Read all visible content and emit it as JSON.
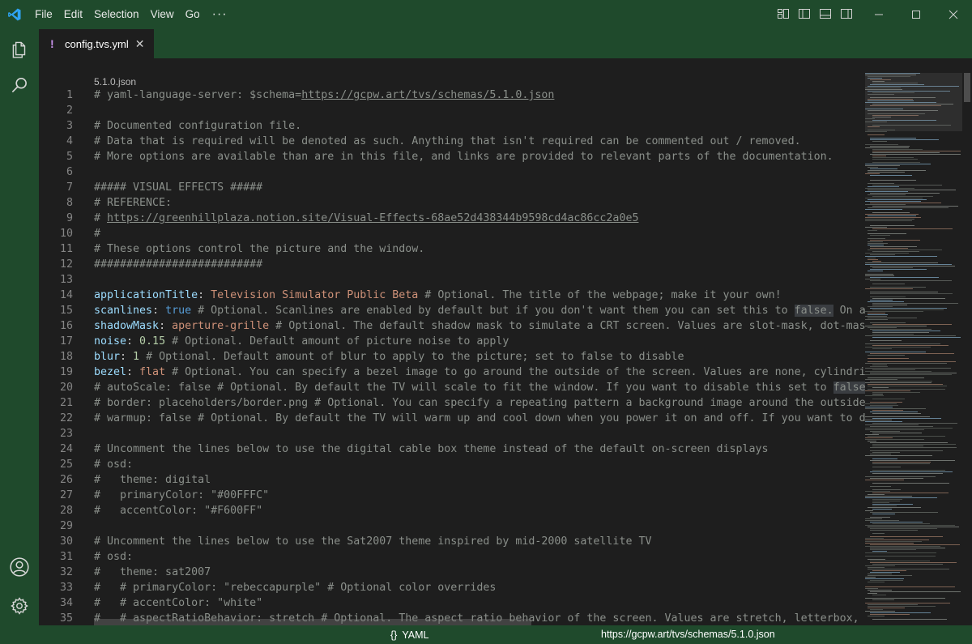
{
  "window": {
    "menu": [
      "File",
      "Edit",
      "Selection",
      "View",
      "Go"
    ],
    "more_label": "···"
  },
  "tab": {
    "icon": "!",
    "label": "config.tvs.yml",
    "close": "✕"
  },
  "editor": {
    "breadcrumb": "5.1.0.json",
    "lines": [
      {
        "n": "1",
        "seg": [
          {
            "t": "# yaml-language-server: $schema=",
            "c": "t-c"
          },
          {
            "t": "https://gcpw.art/tvs/schemas/5.1.0.json",
            "c": "t-u"
          }
        ]
      },
      {
        "n": "2",
        "seg": []
      },
      {
        "n": "3",
        "seg": [
          {
            "t": "# Documented configuration file.",
            "c": "t-c"
          }
        ]
      },
      {
        "n": "4",
        "seg": [
          {
            "t": "# Data that is required will be denoted as such. Anything that isn't required can be commented out / removed.",
            "c": "t-c"
          }
        ]
      },
      {
        "n": "5",
        "seg": [
          {
            "t": "# More options are available than are in this file, and links are provided to relevant parts of the documentation.",
            "c": "t-c"
          }
        ]
      },
      {
        "n": "6",
        "seg": []
      },
      {
        "n": "7",
        "seg": [
          {
            "t": "##### VISUAL EFFECTS #####",
            "c": "t-c"
          }
        ]
      },
      {
        "n": "8",
        "seg": [
          {
            "t": "# REFERENCE:",
            "c": "t-c"
          }
        ]
      },
      {
        "n": "9",
        "seg": [
          {
            "t": "# ",
            "c": "t-c"
          },
          {
            "t": "https://greenhillplaza.notion.site/Visual-Effects-68ae52d438344b9598cd4ac86cc2a0e5",
            "c": "t-u"
          }
        ]
      },
      {
        "n": "10",
        "seg": [
          {
            "t": "#",
            "c": "t-c"
          }
        ]
      },
      {
        "n": "11",
        "seg": [
          {
            "t": "# These options control the picture and the window.",
            "c": "t-c"
          }
        ]
      },
      {
        "n": "12",
        "seg": [
          {
            "t": "##########################",
            "c": "t-c"
          }
        ]
      },
      {
        "n": "13",
        "seg": []
      },
      {
        "n": "14",
        "seg": [
          {
            "t": "applicationTitle",
            "c": "t-k"
          },
          {
            "t": ": ",
            "c": ""
          },
          {
            "t": "Television Simulator Public Beta",
            "c": "t-s"
          },
          {
            "t": " # Optional. The title of the webpage; make it your own!",
            "c": "t-c"
          }
        ]
      },
      {
        "n": "15",
        "seg": [
          {
            "t": "scanlines",
            "c": "t-k"
          },
          {
            "t": ": ",
            "c": ""
          },
          {
            "t": "true",
            "c": "t-b"
          },
          {
            "t": " # Optional. Scanlines are enabled by default but if you don't want them you can set this to ",
            "c": "t-c"
          },
          {
            "t": "false.",
            "c": "t-h"
          },
          {
            "t": " On a real",
            "c": "t-c"
          }
        ]
      },
      {
        "n": "16",
        "seg": [
          {
            "t": "shadowMask",
            "c": "t-k"
          },
          {
            "t": ": ",
            "c": ""
          },
          {
            "t": "aperture-grille",
            "c": "t-s"
          },
          {
            "t": " # Optional. The default shadow mask to simulate a CRT screen. Values are slot-mask, dot-mask, or",
            "c": "t-c"
          }
        ]
      },
      {
        "n": "17",
        "seg": [
          {
            "t": "noise",
            "c": "t-k"
          },
          {
            "t": ": ",
            "c": ""
          },
          {
            "t": "0.15",
            "c": "t-n"
          },
          {
            "t": " # Optional. Default amount of picture noise to apply",
            "c": "t-c"
          }
        ]
      },
      {
        "n": "18",
        "seg": [
          {
            "t": "blur",
            "c": "t-k"
          },
          {
            "t": ": ",
            "c": ""
          },
          {
            "t": "1",
            "c": "t-n"
          },
          {
            "t": " # Optional. Default amount of blur to apply to the picture; set to false to disable",
            "c": "t-c"
          }
        ]
      },
      {
        "n": "19",
        "seg": [
          {
            "t": "bezel",
            "c": "t-k"
          },
          {
            "t": ": ",
            "c": ""
          },
          {
            "t": "flat",
            "c": "t-s"
          },
          {
            "t": " # Optional. You can specify a bezel image to go around the outside of the screen. Values are none, cylindrical or",
            "c": "t-c"
          }
        ]
      },
      {
        "n": "20",
        "seg": [
          {
            "t": "# autoScale: false # Optional. By default the TV will scale to fit the window. If you want to disable this set to ",
            "c": "t-c"
          },
          {
            "t": "false.",
            "c": "t-h"
          }
        ]
      },
      {
        "n": "21",
        "seg": [
          {
            "t": "# border: placeholders/border.png # Optional. You can specify a repeating pattern a background image around the outside of t",
            "c": "t-c"
          }
        ]
      },
      {
        "n": "22",
        "seg": [
          {
            "t": "# warmup: false # Optional. By default the TV will warm up and cool down when you power it on and off. If you want to disab",
            "c": "t-c"
          }
        ]
      },
      {
        "n": "23",
        "seg": []
      },
      {
        "n": "24",
        "seg": [
          {
            "t": "# Uncomment the lines below to use the digital cable box theme instead of the default on-screen displays",
            "c": "t-c"
          }
        ]
      },
      {
        "n": "25",
        "seg": [
          {
            "t": "# osd:",
            "c": "t-c"
          }
        ]
      },
      {
        "n": "26",
        "seg": [
          {
            "t": "#   theme: digital",
            "c": "t-c"
          }
        ]
      },
      {
        "n": "27",
        "seg": [
          {
            "t": "#   primaryColor: \"#00FFFC\"",
            "c": "t-c"
          }
        ]
      },
      {
        "n": "28",
        "seg": [
          {
            "t": "#   accentColor: \"#F600FF\"",
            "c": "t-c"
          }
        ]
      },
      {
        "n": "29",
        "seg": []
      },
      {
        "n": "30",
        "seg": [
          {
            "t": "# Uncomment the lines below to use the Sat2007 theme inspired by mid-2000 satellite TV",
            "c": "t-c"
          }
        ]
      },
      {
        "n": "31",
        "seg": [
          {
            "t": "# osd:",
            "c": "t-c"
          }
        ]
      },
      {
        "n": "32",
        "seg": [
          {
            "t": "#   theme: sat2007",
            "c": "t-c"
          }
        ]
      },
      {
        "n": "33",
        "seg": [
          {
            "t": "#   # primaryColor: \"rebeccapurple\" # Optional color overrides",
            "c": "t-c"
          }
        ]
      },
      {
        "n": "34",
        "seg": [
          {
            "t": "#   # accentColor: \"white\"",
            "c": "t-c"
          }
        ]
      },
      {
        "n": "35",
        "seg": [
          {
            "t": "#   # aspectRatioBehavior: stretch # Optional. The aspect ratio behavior of the screen. Values are stretch, letterbox, or hy",
            "c": "t-c"
          }
        ]
      }
    ]
  },
  "status": {
    "language_icon": "{}",
    "language": "YAML",
    "schema": "https://gcpw.art/tvs/schemas/5.1.0.json"
  },
  "colors": {
    "chrome": "#1f4a2c",
    "editor_bg": "#1e1e1e",
    "comment": "#8a8f8a",
    "key": "#9cdcfe",
    "string": "#ce9178",
    "boolean": "#569cd6",
    "number": "#b5cea8"
  }
}
